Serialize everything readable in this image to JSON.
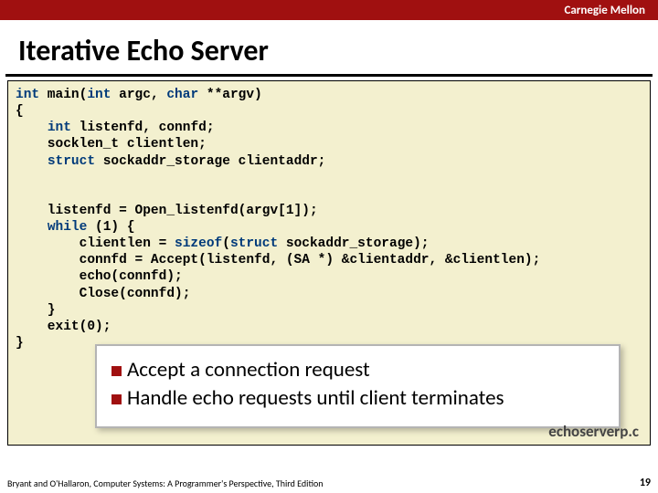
{
  "brand": "Carnegie Mellon",
  "title": "Iterative Echo Server",
  "code": {
    "l1a": "int",
    "l1b": " main(",
    "l1c": "int",
    "l1d": " argc, ",
    "l1e": "char",
    "l1f": " **argv)",
    "l2": "{",
    "l3a": "    ",
    "l3b": "int",
    "l3c": " listenfd, connfd;",
    "l4": "    socklen_t clientlen;",
    "l5a": "    ",
    "l5b": "struct",
    "l5c": " sockaddr_storage clientaddr;",
    "blank1": " ",
    "blank2": " ",
    "l6": "    listenfd = Open_listenfd(argv[1]);",
    "l7a": "    ",
    "l7b": "while",
    "l7c": " (1) {",
    "l8a": "        clientlen = ",
    "l8b": "sizeof",
    "l8c": "(",
    "l8d": "struct",
    "l8e": " sockaddr_storage);",
    "l9": "        connfd = Accept(listenfd, (SA *) &clientaddr, &clientlen);",
    "l10": "        echo(connfd);",
    "l11": "        Close(connfd);",
    "l12": "    }",
    "l13": "    exit(0);",
    "l14": "}"
  },
  "notes": {
    "n1": "Accept a connection request",
    "n2": "Handle echo requests until client terminates"
  },
  "filename": "echoserverp.c",
  "footer_left": "Bryant and O'Hallaron, Computer Systems: A Programmer's Perspective, Third Edition",
  "page_number": "19"
}
